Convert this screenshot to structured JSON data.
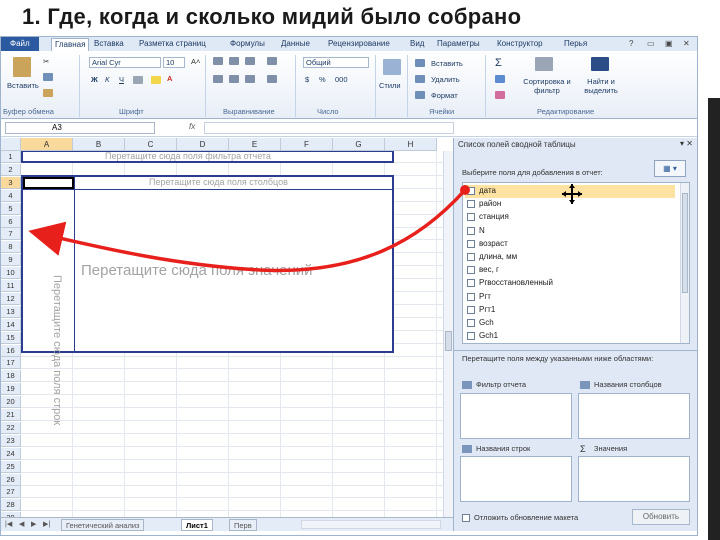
{
  "slide_title": "1. Где, когда и сколько мидий было собрано",
  "menu": {
    "tabs": [
      "Файл",
      "Главная",
      "Вставка",
      "Разметка страниц",
      "Формулы",
      "Данные",
      "Рецензирование",
      "Вид",
      "Параметры",
      "Конструктор",
      "Перья"
    ]
  },
  "ribbon": {
    "clipboard": {
      "paste": "Вставить",
      "group": "Буфер обмена"
    },
    "font": {
      "name": "Arial Cyr",
      "size": "10",
      "bold": "Ж",
      "italic": "К",
      "underline": "Ч",
      "group": "Шрифт"
    },
    "alignment": {
      "group": "Выравнивание"
    },
    "number": {
      "format": "Общий",
      "currency": "$",
      "percent": "%",
      "group": "Число"
    },
    "styles": {
      "label": "Стили"
    },
    "cells": {
      "insert": "Вставить",
      "delete": "Удалить",
      "format": "Формат",
      "group": "Ячейки"
    },
    "editing": {
      "sum": "Σ",
      "sort": "Сортировка и фильтр",
      "find": "Найти и выделить",
      "group": "Редактирование"
    }
  },
  "formula_bar": {
    "namebox": "A3",
    "fx": "fx",
    "value": ""
  },
  "grid": {
    "columns": [
      "A",
      "B",
      "C",
      "D",
      "E",
      "F",
      "G",
      "H"
    ],
    "rows": [
      "1",
      "2",
      "3",
      "4",
      "5",
      "6",
      "7",
      "8",
      "9",
      "10",
      "11",
      "12",
      "13",
      "14",
      "15",
      "16",
      "17",
      "18",
      "19",
      "20",
      "21",
      "22",
      "23",
      "24",
      "25",
      "26",
      "27",
      "28",
      "29"
    ],
    "selected_column": "A",
    "selected_row": "3",
    "pivot": {
      "filter_drop": "Перетащите сюда поля фильтра отчета",
      "column_drop": "Перетащите сюда поля столбцов",
      "row_drop": "Перетащите сюда поля строк",
      "values_drop": "Перетащите сюда поля значений"
    }
  },
  "sheet_tabs": [
    "Генетический анализ",
    "Лист1",
    "Перв"
  ],
  "field_list": {
    "title": "Список полей сводной таблицы",
    "instruction": "Выберите поля для добавления в отчет:",
    "layout_button": "▾",
    "fields": [
      {
        "name": "дата",
        "highlighted": true
      },
      {
        "name": "район",
        "highlighted": false
      },
      {
        "name": "станция",
        "highlighted": false
      },
      {
        "name": "N",
        "highlighted": false
      },
      {
        "name": "возраст",
        "highlighted": false
      },
      {
        "name": "длина, мм",
        "highlighted": false
      },
      {
        "name": "вес, г",
        "highlighted": false
      },
      {
        "name": "Ргвосстановленный",
        "highlighted": false
      },
      {
        "name": "Ргт",
        "highlighted": false
      },
      {
        "name": "Ргт1",
        "highlighted": false
      },
      {
        "name": "Gch",
        "highlighted": false
      },
      {
        "name": "Gch1",
        "highlighted": false
      }
    ],
    "areas_instruction": "Перетащите поля между указанными ниже областями:",
    "areas": {
      "filter": "Фильтр отчета",
      "columns": "Названия столбцов",
      "rows": "Названия строк",
      "values": "Значения"
    },
    "defer_update": "Отложить обновление макета",
    "update_button": "Обновить"
  },
  "colors": {
    "arrow": "#e8201c",
    "pivot_border": "#2a3d8f",
    "highlight": "#fde2a1",
    "ribbon_blue": "#2c5aa0"
  }
}
